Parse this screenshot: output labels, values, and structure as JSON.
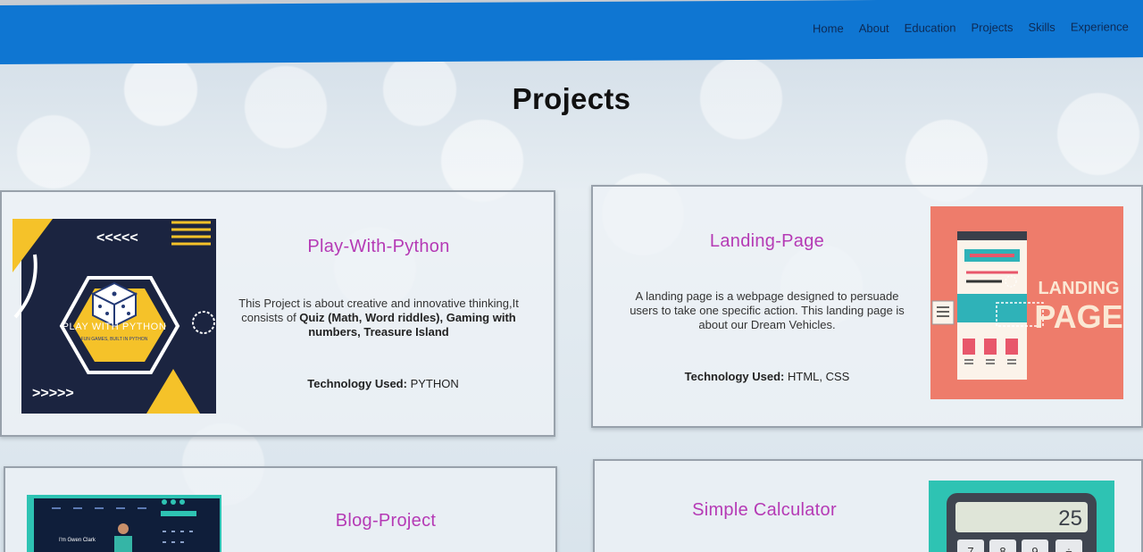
{
  "nav": {
    "items": [
      {
        "label": "Home"
      },
      {
        "label": "About"
      },
      {
        "label": "Education"
      },
      {
        "label": "Projects"
      },
      {
        "label": "Skills"
      },
      {
        "label": "Experience"
      }
    ]
  },
  "page": {
    "title": "Projects"
  },
  "projects": [
    {
      "title": "Play-With-Python",
      "desc_part1": "This Project is about creative and innovative thinking,It consists of ",
      "desc_bold": "Quiz (Math, Word riddles), Gaming with numbers, Treasure Island",
      "tech_label": "Technology Used:",
      "tech_value": "PYTHON",
      "thumb_text": "PLAY WITH PYTHON",
      "thumb_subtext": "FUN GAMES, BUILT IN PYTHON",
      "thumb_arrows_left": "<<<<<",
      "thumb_arrows_right": ">>>>>"
    },
    {
      "title": "Landing-Page",
      "desc": "A landing page is a webpage designed to persuade users to take one specific action. This landing page is about our Dream Vehicles.",
      "tech_label": "Technology Used:",
      "tech_value": "HTML, CSS",
      "thumb_text_1": "LANDING",
      "thumb_text_2": "PAGE"
    },
    {
      "title": "Blog-Project",
      "thumb_text": "I'm Gwen Clark"
    },
    {
      "title": "Simple Calculator",
      "thumb_display": "25",
      "thumb_keys": [
        "7",
        "8",
        "9",
        "÷"
      ]
    }
  ],
  "colors": {
    "navbar": "#0f76d2",
    "card_title": "#b53ab5",
    "python_thumb_bg": "#1b2440",
    "python_thumb_accent": "#f5c229",
    "landing_thumb_bg": "#ee7c6b",
    "landing_thumb_teal": "#2fb2b8",
    "calc_thumb_bg": "#2ec3b3"
  }
}
